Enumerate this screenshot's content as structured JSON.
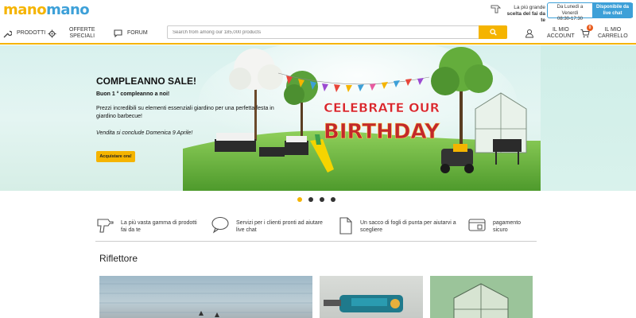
{
  "brand": {
    "part1": "mano",
    "part2": "mano"
  },
  "header": {
    "promo_line1": "La più grande",
    "promo_line2": "scelta del fai da te",
    "hours_line1": "Da Lunedì a Venerdì",
    "hours_line2": "08:30-17:30",
    "chat_line1": "Disponibile da",
    "chat_line2": "live chat"
  },
  "nav": {
    "products": "PRODOTTI",
    "offers_line1": "OFFERTE",
    "offers_line2": "SPECIALI",
    "forum": "FORUM",
    "search_placeholder": "Search from among our 185,000 products",
    "account_line1": "IL MIO",
    "account_line2": "ACCOUNT",
    "cart_line1": "IL MIO",
    "cart_line2": "CARRELLO",
    "cart_count": "0"
  },
  "hero": {
    "title": "COMPLEANNO SALE!",
    "subtitle": "Buon 1 ° compleanno a noi!",
    "description": "Prezzi incredibili su elementi essenziali giardino per una perfetta festa in giardino barbecue!",
    "end_text": "Vendita si conclude Domenica 9 Aprile!",
    "cta": "Acquistare ora!",
    "banner_line1": "CELEBRATE OUR",
    "banner_line2": "BIRTHDAY",
    "slide_count": 4,
    "active_slide": 1
  },
  "features": [
    {
      "icon": "drill-icon",
      "line1": "La più vasta gamma di prodotti",
      "line2": "fai da te"
    },
    {
      "icon": "chat-bubble-icon",
      "line1": "Servizi per i clienti pronti ad aiutare",
      "line2": "live chat"
    },
    {
      "icon": "document-icon",
      "line1": "Un sacco di fogli di punta per aiutarvi a",
      "line2": "scegliere"
    },
    {
      "icon": "secure-payment-icon",
      "line1": "pagamento",
      "line2": "sicuro"
    }
  ],
  "spotlight": {
    "title": "Riflettore"
  },
  "colors": {
    "accent": "#f5b400",
    "brand_blue": "#3da0d8"
  }
}
